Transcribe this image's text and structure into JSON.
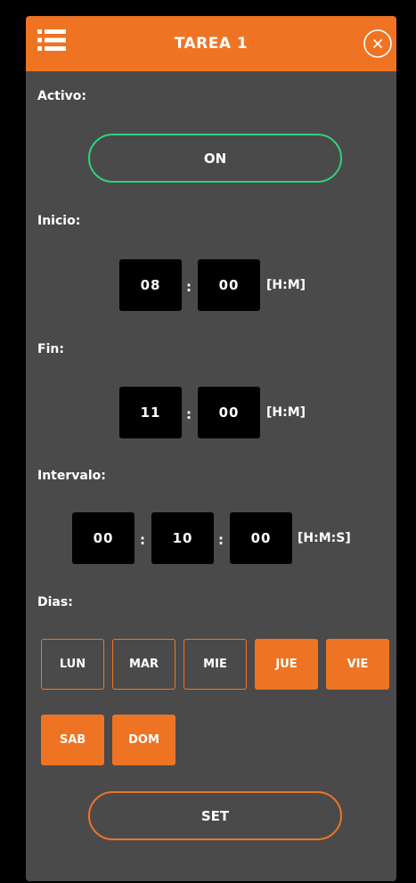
{
  "header": {
    "title": "TAREA 1",
    "menu_icon": "hamburger-menu-icon",
    "close_icon": "close-circle-icon"
  },
  "colors": {
    "accent": "#ee7424",
    "on_border": "#2fd27a",
    "panel": "#4a4a4a",
    "field": "#000000"
  },
  "activo": {
    "label": "Activo:",
    "button": "ON"
  },
  "inicio": {
    "label": "Inicio:",
    "hours": "08",
    "minutes": "00",
    "separator": ":",
    "unit": "[H:M]"
  },
  "fin": {
    "label": "Fin:",
    "hours": "11",
    "minutes": "00",
    "separator": ":",
    "unit": "[H:M]"
  },
  "intervalo": {
    "label": "Intervalo:",
    "hours": "00",
    "minutes": "10",
    "seconds": "00",
    "separator": ":",
    "unit": "[H:M:S]"
  },
  "dias": {
    "label": "Dias:",
    "days": [
      {
        "label": "LUN",
        "active": false
      },
      {
        "label": "MAR",
        "active": false
      },
      {
        "label": "MIE",
        "active": false
      },
      {
        "label": "JUE",
        "active": true
      },
      {
        "label": "VIE",
        "active": true
      },
      {
        "label": "SAB",
        "active": true
      },
      {
        "label": "DOM",
        "active": true
      }
    ]
  },
  "set_button": "SET"
}
